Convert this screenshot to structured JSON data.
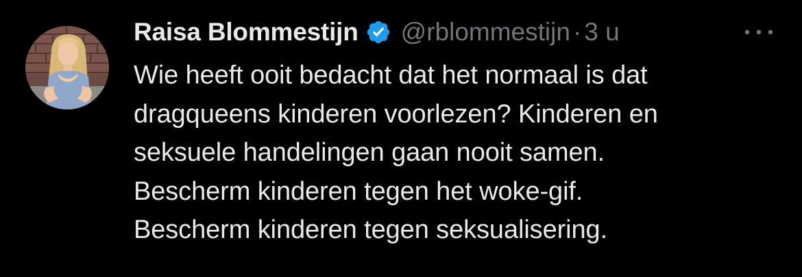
{
  "tweet": {
    "author": {
      "display_name": "Raisa Blommestijn",
      "handle": "@rblommestijn",
      "verified_icon": "verified-badge-icon"
    },
    "separator": "·",
    "timestamp": "3 u",
    "more_icon": "more-options-icon",
    "lines": [
      "Wie heeft ooit bedacht dat het normaal is dat",
      "dragqueens kinderen voorlezen? Kinderen en",
      "seksuele handelingen gaan nooit samen.",
      "Bescherm kinderen tegen het woke-gif.",
      "Bescherm kinderen tegen seksualisering."
    ]
  },
  "colors": {
    "background": "#000000",
    "text_primary": "#e7e9ea",
    "text_secondary": "#71767b",
    "verified": "#1d9bf0"
  }
}
